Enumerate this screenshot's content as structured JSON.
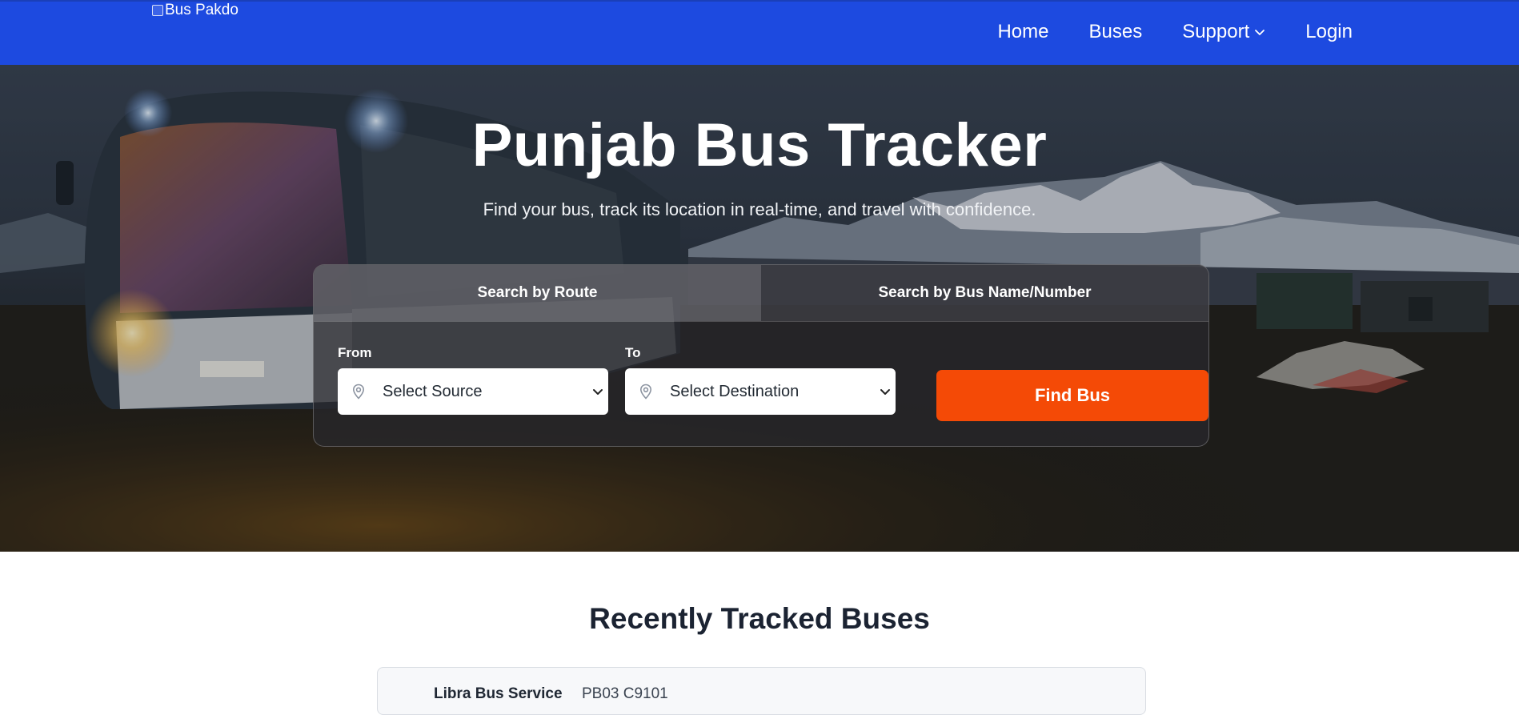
{
  "navbar": {
    "logo_alt": "Bus Pakdo",
    "links": [
      "Home",
      "Buses",
      "Support",
      "Login"
    ],
    "bg_color": "#1d4ae0"
  },
  "hero": {
    "title": "Punjab Bus Tracker",
    "subtitle": "Find your bus, track its location in real-time, and travel with confidence."
  },
  "search": {
    "tabs": [
      "Search by Route",
      "Search by Bus Name/Number"
    ],
    "active_tab": "Search by Route",
    "from_label": "From",
    "from_value": "Select Source",
    "to_label": "To",
    "to_value": "Select Destination",
    "button_label": "Find Bus",
    "button_color": "#f44a06",
    "icons": [
      "map-pin-icon",
      "chevron-down-icon"
    ]
  },
  "recent": {
    "title": "Recently Tracked Buses",
    "items": [
      {
        "name": "Libra Bus Service",
        "number": "PB03 C9101"
      }
    ]
  }
}
